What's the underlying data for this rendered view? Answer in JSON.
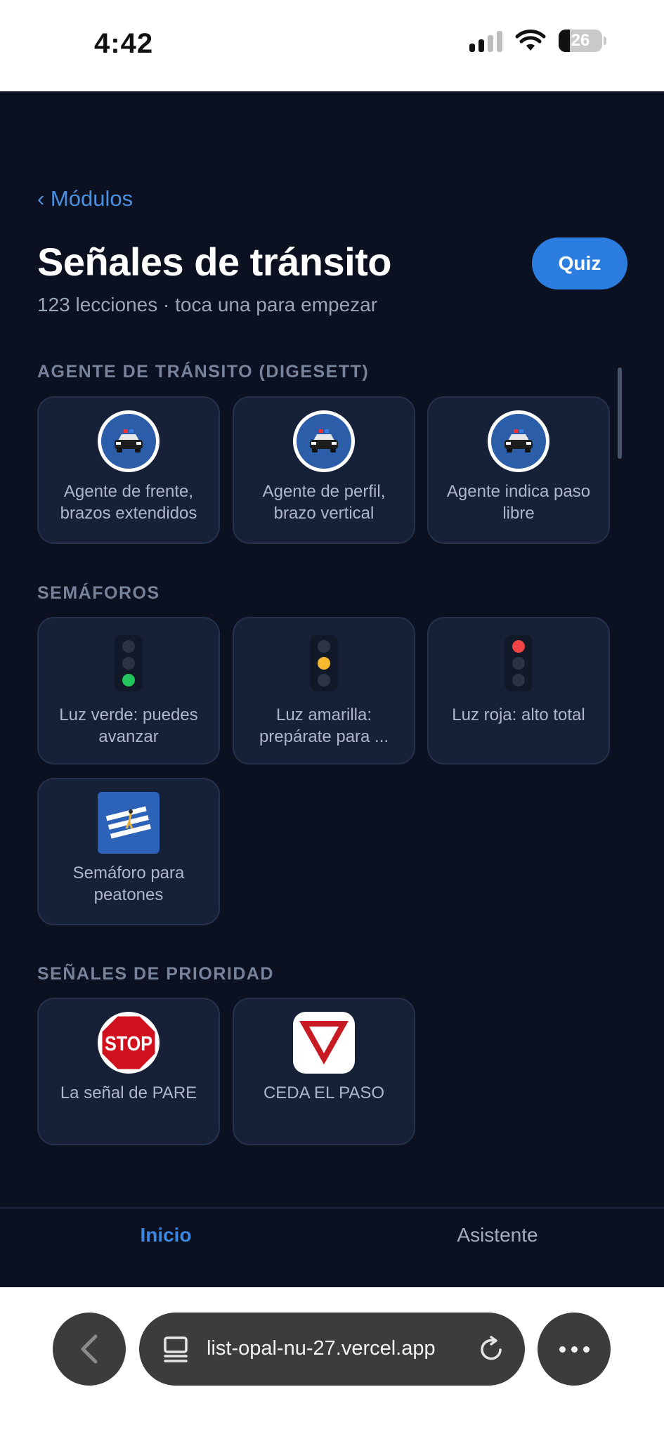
{
  "status_bar": {
    "time": "4:42",
    "battery": "26"
  },
  "header": {
    "back_label": "‹ Módulos",
    "title": "Señales de tránsito",
    "subtitle": "123 lecciones · toca una para empezar",
    "quiz_label": "Quiz"
  },
  "sections": [
    {
      "title": "AGENTE DE TRÁNSITO (DIGESETT)",
      "cards": [
        {
          "label": "Agente de frente, brazos extendidos",
          "icon": "police-car-icon"
        },
        {
          "label": "Agente de perfil, brazo vertical",
          "icon": "police-car-icon"
        },
        {
          "label": "Agente indica paso libre",
          "icon": "police-car-icon"
        }
      ]
    },
    {
      "title": "SEMÁFOROS",
      "cards": [
        {
          "label": "Luz verde: puedes avanzar",
          "icon": "traffic-light-green-icon",
          "active_color": "#22c55e"
        },
        {
          "label": "Luz amarilla: prepárate para ...",
          "icon": "traffic-light-yellow-icon",
          "active_color": "#f5b82e"
        },
        {
          "label": "Luz roja: alto total",
          "icon": "traffic-light-red-icon",
          "active_color": "#ef4444"
        },
        {
          "label": "Semáforo para peatones",
          "icon": "pedestrian-crossing-icon"
        }
      ]
    },
    {
      "title": "SEÑALES DE PRIORIDAD",
      "cards": [
        {
          "label": "La señal de PARE",
          "icon": "stop-sign-icon",
          "sign_text": "STOP"
        },
        {
          "label": "CEDA EL PASO",
          "icon": "yield-sign-icon"
        }
      ]
    }
  ],
  "tabs": {
    "home": "Inicio",
    "assistant": "Asistente"
  },
  "browser": {
    "url": "list-opal-nu-27.vercel.app"
  },
  "colors": {
    "background": "#0b1120",
    "card": "#162036",
    "accent": "#2b7de0",
    "stop_red": "#d0101e"
  }
}
